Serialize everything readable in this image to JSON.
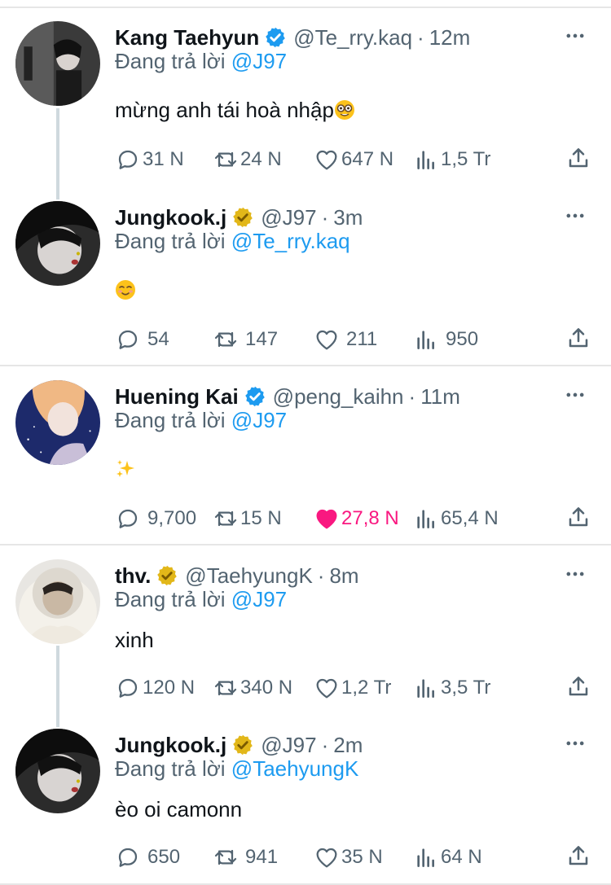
{
  "reply_prefix": "Đang trả lời",
  "colors": {
    "text": "#0f1419",
    "muted": "#536471",
    "link": "#1d9bf0",
    "like_active": "#f91880",
    "verified_blue": "#1d9bf0",
    "verified_gold": "#e2b719"
  },
  "tweets": [
    {
      "name": "Kang Taehyun",
      "verified": "blue",
      "handle": "@Te_rry.kaq",
      "time": "12m",
      "reply_to": "@J97",
      "text": "mừng anh tái hoà nhập",
      "text_emoji": "nerd-face-icon",
      "replies": "31 N",
      "retweets": "24 N",
      "likes": "647 N",
      "views": "1,5 Tr",
      "liked": false
    },
    {
      "name": "Jungkook.j",
      "verified": "gold",
      "handle": "@J97",
      "time": "3m",
      "reply_to": "@Te_rry.kaq",
      "text": "",
      "text_emoji": "smiling-face-icon",
      "replies": "54",
      "retweets": "147",
      "likes": "211",
      "views": "950",
      "liked": false
    },
    {
      "name": "Huening Kai",
      "verified": "blue",
      "handle": "@peng_kaihn",
      "time": "11m",
      "reply_to": "@J97",
      "text": "",
      "text_emoji": "sparkles-icon",
      "replies": "9,700",
      "retweets": "15 N",
      "likes": "27,8 N",
      "views": "65,4 N",
      "liked": true
    },
    {
      "name": "thv.",
      "verified": "gold",
      "handle": "@TaehyungK",
      "time": "8m",
      "reply_to": "@J97",
      "text": "xinh",
      "text_emoji": "",
      "replies": "120 N",
      "retweets": "340 N",
      "likes": "1,2 Tr",
      "views": "3,5 Tr",
      "liked": false
    },
    {
      "name": "Jungkook.j",
      "verified": "gold",
      "handle": "@J97",
      "time": "2m",
      "reply_to": "@TaehyungK",
      "text": "èo oi camonn",
      "text_emoji": "",
      "replies": "650",
      "retweets": "941",
      "likes": "35 N",
      "views": "64 N",
      "liked": false
    }
  ]
}
